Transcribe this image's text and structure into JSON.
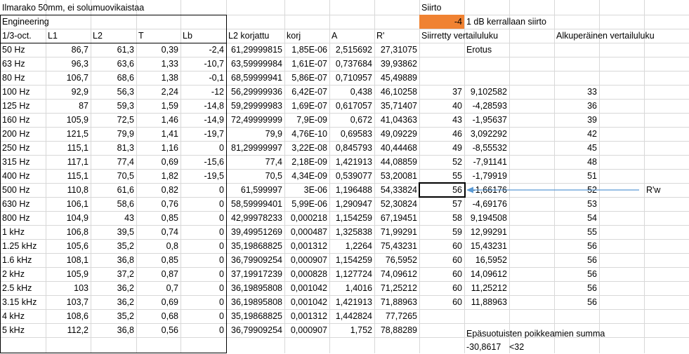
{
  "sheet": {
    "title": "Ilmarako 50mm, ei solumuovikaistaa",
    "section": "Engineering",
    "siirto_label": "Siirto",
    "siirto_value": "-4",
    "siirto_note": "1 dB kerrallaan siirto",
    "headers": {
      "band": "1/3-oct.",
      "L1": "L1",
      "L2": "L2",
      "T": "T",
      "Lb": "Lb",
      "L2k": "L2 korjattu",
      "korj": "korj",
      "A": "A",
      "R": "R'",
      "shifted": "Siirretty vertailuluku",
      "original": "Alkuperäinen vertailuluku",
      "diff": "Erotus"
    },
    "rows": [
      {
        "band": "50 Hz",
        "L1": "86,7",
        "L2": "61,3",
        "T": "0,39",
        "Lb": "-2,4",
        "L2k": "61,29999815",
        "korj": "1,85E-06",
        "A": "2,515692",
        "R": "27,31075",
        "shifted": "",
        "diff": "",
        "orig": ""
      },
      {
        "band": "63 Hz",
        "L1": "96,3",
        "L2": "63,6",
        "T": "1,33",
        "Lb": "-10,7",
        "L2k": "63,59999984",
        "korj": "1,61E-07",
        "A": "0,737684",
        "R": "39,93862",
        "shifted": "",
        "diff": "",
        "orig": ""
      },
      {
        "band": "80 Hz",
        "L1": "106,7",
        "L2": "68,6",
        "T": "1,38",
        "Lb": "-0,1",
        "L2k": "68,59999941",
        "korj": "5,86E-07",
        "A": "0,710957",
        "R": "45,49889",
        "shifted": "",
        "diff": "",
        "orig": ""
      },
      {
        "band": "100 Hz",
        "L1": "92,9",
        "L2": "56,3",
        "T": "2,24",
        "Lb": "-12",
        "L2k": "56,29999936",
        "korj": "6,42E-07",
        "A": "0,438",
        "R": "46,10258",
        "shifted": "37",
        "diff": "9,102582",
        "orig": "33"
      },
      {
        "band": "125 Hz",
        "L1": "87",
        "L2": "59,3",
        "T": "1,59",
        "Lb": "-14,8",
        "L2k": "59,29999983",
        "korj": "1,69E-07",
        "A": "0,617057",
        "R": "35,71407",
        "shifted": "40",
        "diff": "-4,28593",
        "orig": "36"
      },
      {
        "band": "160 Hz",
        "L1": "105,9",
        "L2": "72,5",
        "T": "1,46",
        "Lb": "-14,9",
        "L2k": "72,49999999",
        "korj": "7,9E-09",
        "A": "0,672",
        "R": "41,04363",
        "shifted": "43",
        "diff": "-1,95637",
        "orig": "39"
      },
      {
        "band": "200 Hz",
        "L1": "121,5",
        "L2": "79,9",
        "T": "1,41",
        "Lb": "-19,7",
        "L2k": "79,9",
        "korj": "4,76E-10",
        "A": "0,69583",
        "R": "49,09229",
        "shifted": "46",
        "diff": "3,092292",
        "orig": "42"
      },
      {
        "band": "250 Hz",
        "L1": "115,1",
        "L2": "81,3",
        "T": "1,16",
        "Lb": "0",
        "L2k": "81,29999997",
        "korj": "3,22E-08",
        "A": "0,845793",
        "R": "40,44468",
        "shifted": "49",
        "diff": "-8,55532",
        "orig": "45"
      },
      {
        "band": "315 Hz",
        "L1": "117,1",
        "L2": "77,4",
        "T": "0,69",
        "Lb": "-15,6",
        "L2k": "77,4",
        "korj": "2,18E-09",
        "A": "1,421913",
        "R": "44,08859",
        "shifted": "52",
        "diff": "-7,91141",
        "orig": "48"
      },
      {
        "band": "400 Hz",
        "L1": "115,1",
        "L2": "70,5",
        "T": "1,82",
        "Lb": "-19,5",
        "L2k": "70,5",
        "korj": "4,34E-09",
        "A": "0,539077",
        "R": "53,20081",
        "shifted": "55",
        "diff": "-1,79919",
        "orig": "51"
      },
      {
        "band": "500 Hz",
        "L1": "110,8",
        "L2": "61,6",
        "T": "0,82",
        "Lb": "0",
        "L2k": "61,599997",
        "korj": "3E-06",
        "A": "1,196488",
        "R": "54,33824",
        "shifted": "56",
        "diff": "-1,66176",
        "orig": "52"
      },
      {
        "band": "630 Hz",
        "L1": "106,1",
        "L2": "58,6",
        "T": "0,76",
        "Lb": "0",
        "L2k": "58,59999401",
        "korj": "5,99E-06",
        "A": "1,290947",
        "R": "52,30824",
        "shifted": "57",
        "diff": "-4,69176",
        "orig": "53"
      },
      {
        "band": "800 Hz",
        "L1": "104,9",
        "L2": "43",
        "T": "0,85",
        "Lb": "0",
        "L2k": "42,99978233",
        "korj": "0,000218",
        "A": "1,154259",
        "R": "67,19451",
        "shifted": "58",
        "diff": "9,194508",
        "orig": "54"
      },
      {
        "band": "1 kHz",
        "L1": "106,8",
        "L2": "39,5",
        "T": "0,74",
        "Lb": "0",
        "L2k": "39,49951269",
        "korj": "0,000487",
        "A": "1,325838",
        "R": "71,99291",
        "shifted": "59",
        "diff": "12,99291",
        "orig": "55"
      },
      {
        "band": "1.25 kHz",
        "L1": "105,6",
        "L2": "35,2",
        "T": "0,8",
        "Lb": "0",
        "L2k": "35,19868825",
        "korj": "0,001312",
        "A": "1,2264",
        "R": "75,43231",
        "shifted": "60",
        "diff": "15,43231",
        "orig": "56"
      },
      {
        "band": "1.6 kHz",
        "L1": "108,1",
        "L2": "36,8",
        "T": "0,85",
        "Lb": "0",
        "L2k": "36,79909254",
        "korj": "0,000907",
        "A": "1,154259",
        "R": "76,5952",
        "shifted": "60",
        "diff": "16,5952",
        "orig": "56"
      },
      {
        "band": "2 kHz",
        "L1": "105,9",
        "L2": "37,2",
        "T": "0,87",
        "Lb": "0",
        "L2k": "37,19917239",
        "korj": "0,000828",
        "A": "1,127724",
        "R": "74,09612",
        "shifted": "60",
        "diff": "14,09612",
        "orig": "56"
      },
      {
        "band": "2.5 kHz",
        "L1": "103",
        "L2": "36,2",
        "T": "0,7",
        "Lb": "0",
        "L2k": "36,19895808",
        "korj": "0,001042",
        "A": "1,4016",
        "R": "71,25212",
        "shifted": "60",
        "diff": "11,25212",
        "orig": "56"
      },
      {
        "band": "3.15 kHz",
        "L1": "103,7",
        "L2": "36,2",
        "T": "0,69",
        "Lb": "0",
        "L2k": "36,19895808",
        "korj": "0,001042",
        "A": "1,421913",
        "R": "71,88963",
        "shifted": "60",
        "diff": "11,88963",
        "orig": "56"
      },
      {
        "band": "4 kHz",
        "L1": "108,6",
        "L2": "35,2",
        "T": "0,68",
        "Lb": "0",
        "L2k": "35,19868825",
        "korj": "0,001312",
        "A": "1,442824",
        "R": "77,7265",
        "shifted": "",
        "diff": "",
        "orig": ""
      },
      {
        "band": "5 kHz",
        "L1": "112,2",
        "L2": "36,8",
        "T": "0,56",
        "Lb": "0",
        "L2k": "36,79909254",
        "korj": "0,000907",
        "A": "1,752",
        "R": "78,88289",
        "shifted": "",
        "diff": "",
        "orig": ""
      }
    ],
    "rw_label": "R'w",
    "sum_label": "Epäsuotuisten poikkeamien summa",
    "sum_value": "-30,8617",
    "sum_condition": "<32",
    "colors": {
      "accent": "#f08232",
      "arrow": "#5b9bd5",
      "grid": "#d8d8d8"
    }
  }
}
